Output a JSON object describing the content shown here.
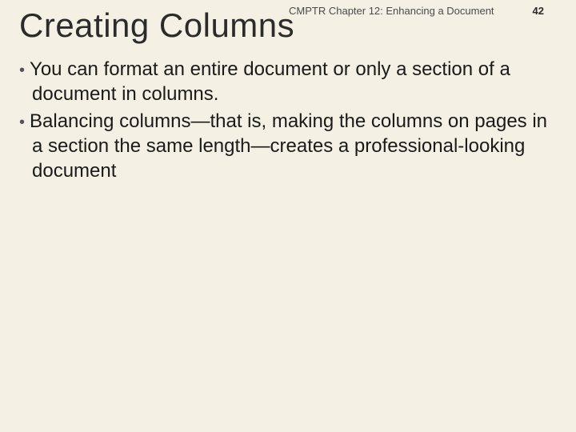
{
  "header": {
    "chapter": "CMPTR Chapter 12: Enhancing a Document",
    "page": "42"
  },
  "title": "Creating Columns",
  "bullets": [
    "You can format an entire document or only a section of a document in columns.",
    "Balancing columns—that is, making the columns on pages in a section the same length—creates a professional-looking document"
  ]
}
